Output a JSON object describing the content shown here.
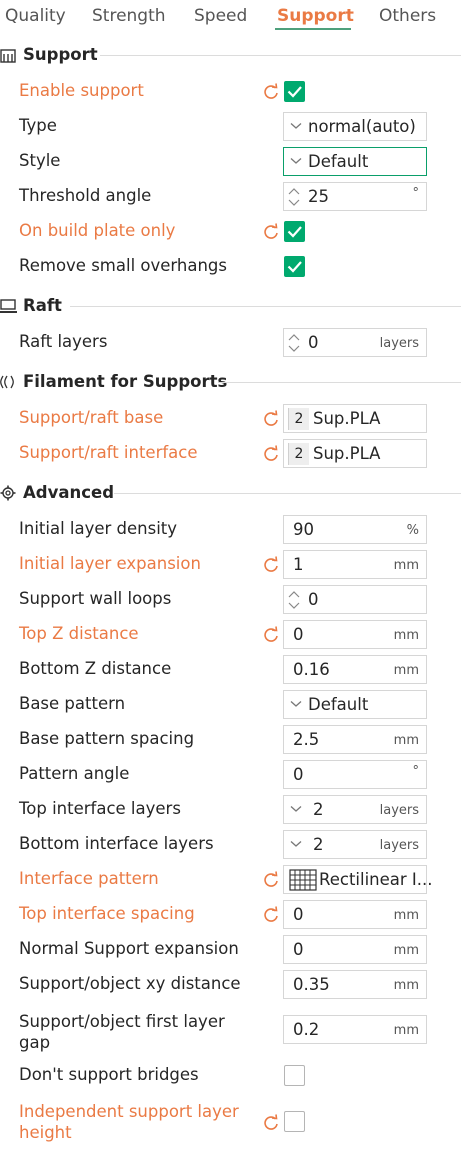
{
  "tabs": [
    {
      "label": "Quality"
    },
    {
      "label": "Strength"
    },
    {
      "label": "Speed"
    },
    {
      "label": "Support"
    },
    {
      "label": "Others"
    }
  ],
  "sections": {
    "support": {
      "title": "Support"
    },
    "raft": {
      "title": "Raft"
    },
    "filament": {
      "title": "Filament for Supports"
    },
    "advanced": {
      "title": "Advanced"
    }
  },
  "settings": {
    "enable_support": {
      "label": "Enable support",
      "checked": true
    },
    "type": {
      "label": "Type",
      "value": "normal(auto)"
    },
    "style": {
      "label": "Style",
      "value": "Default"
    },
    "threshold_angle": {
      "label": "Threshold angle",
      "value": "25",
      "unit": "°"
    },
    "on_build_plate_only": {
      "label": "On build plate only",
      "checked": true
    },
    "remove_small_overhangs": {
      "label": "Remove small overhangs",
      "checked": true
    },
    "raft_layers": {
      "label": "Raft layers",
      "value": "0",
      "unit": "layers"
    },
    "support_raft_base": {
      "label": "Support/raft base",
      "filament_index": "2",
      "value": "Sup.PLA"
    },
    "support_raft_interface": {
      "label": "Support/raft interface",
      "filament_index": "2",
      "value": "Sup.PLA"
    },
    "initial_layer_density": {
      "label": "Initial layer density",
      "value": "90",
      "unit": "%"
    },
    "initial_layer_expansion": {
      "label": "Initial layer expansion",
      "value": "1",
      "unit": "mm"
    },
    "support_wall_loops": {
      "label": "Support wall loops",
      "value": "0"
    },
    "top_z_distance": {
      "label": "Top Z distance",
      "value": "0",
      "unit": "mm"
    },
    "bottom_z_distance": {
      "label": "Bottom Z distance",
      "value": "0.16",
      "unit": "mm"
    },
    "base_pattern": {
      "label": "Base pattern",
      "value": "Default"
    },
    "base_pattern_spacing": {
      "label": "Base pattern spacing",
      "value": "2.5",
      "unit": "mm"
    },
    "pattern_angle": {
      "label": "Pattern angle",
      "value": "0",
      "unit": "°"
    },
    "top_interface_layers": {
      "label": "Top interface layers",
      "value": "2",
      "unit": "layers"
    },
    "bottom_interface_layers": {
      "label": "Bottom interface layers",
      "value": "2",
      "unit": "layers"
    },
    "interface_pattern": {
      "label": "Interface pattern",
      "value": "Rectilinear I..."
    },
    "top_interface_spacing": {
      "label": "Top interface spacing",
      "value": "0",
      "unit": "mm"
    },
    "normal_support_expansion": {
      "label": "Normal Support expansion",
      "value": "0",
      "unit": "mm"
    },
    "support_object_xy_distance": {
      "label": "Support/object xy distance",
      "value": "0.35",
      "unit": "mm"
    },
    "support_object_first_layer_gap": {
      "label": "Support/object first layer gap",
      "value": "0.2",
      "unit": "mm"
    },
    "dont_support_bridges": {
      "label": "Don't support bridges",
      "checked": false
    },
    "independent_support_layer_height": {
      "label": "Independent support layer height",
      "checked": false
    }
  },
  "colors": {
    "accent_changed": "#ea7a44",
    "checkbox_on": "#00a96e",
    "tab_underline": "#4ea07c"
  },
  "icons": [
    "support-section-icon",
    "raft-section-icon",
    "filament-section-icon",
    "gear-icon",
    "reset-arrow-icon",
    "checkmark-icon",
    "spin-arrows-icon",
    "chevron-down-icon",
    "rectilinear-pattern-icon"
  ]
}
